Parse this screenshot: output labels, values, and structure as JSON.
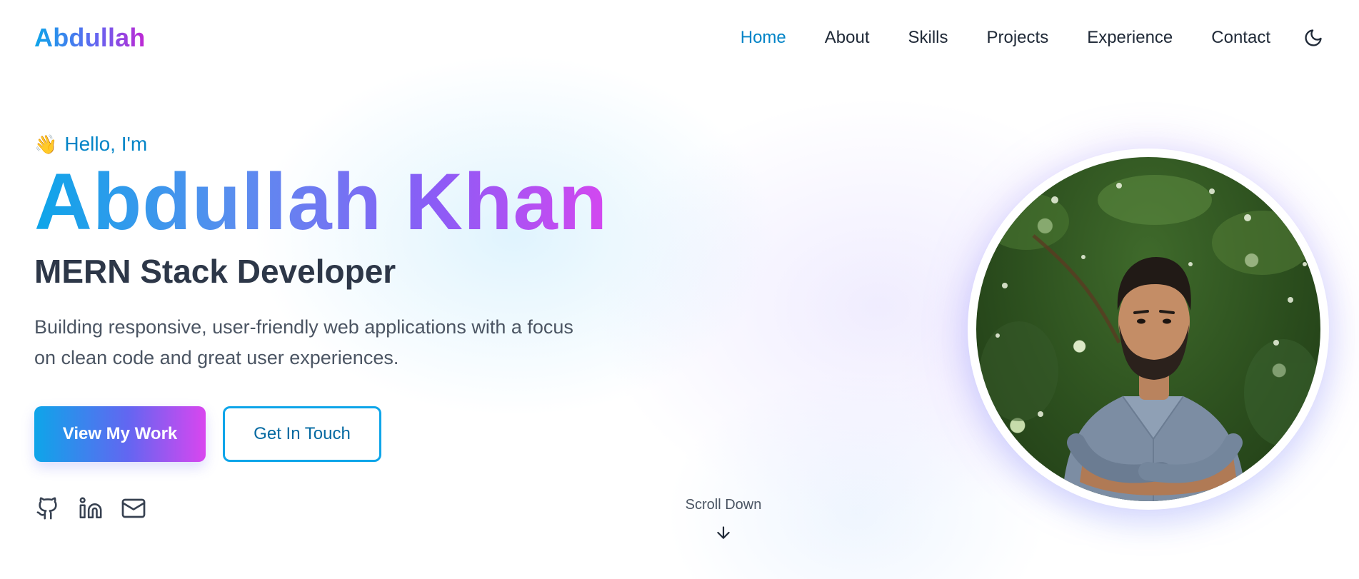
{
  "nav": {
    "brand": "Abdullah",
    "links": [
      {
        "label": "Home",
        "active": true
      },
      {
        "label": "About",
        "active": false
      },
      {
        "label": "Skills",
        "active": false
      },
      {
        "label": "Projects",
        "active": false
      },
      {
        "label": "Experience",
        "active": false
      },
      {
        "label": "Contact",
        "active": false
      }
    ],
    "theme_toggle_icon": "moon-icon"
  },
  "hero": {
    "greeting_emoji": "👋",
    "greeting": "Hello, I'm",
    "name": "Abdullah Khan",
    "role": "MERN Stack Developer",
    "description": "Building responsive, user-friendly web applications with a focus on clean code and great user experiences.",
    "primary_button": "View My Work",
    "secondary_button": "Get In Touch",
    "socials": [
      {
        "icon": "github-icon"
      },
      {
        "icon": "linkedin-icon"
      },
      {
        "icon": "mail-icon"
      }
    ]
  },
  "scroll": {
    "label": "Scroll Down",
    "icon": "arrow-down-icon"
  },
  "portrait": {
    "icon": "profile-photo"
  },
  "colors": {
    "accent": "#0284c7",
    "gradient_start": "#0ea5e9",
    "gradient_mid": "#6366f1",
    "gradient_end": "#d946ef",
    "heading": "#2d3748",
    "body": "#4b5563"
  }
}
